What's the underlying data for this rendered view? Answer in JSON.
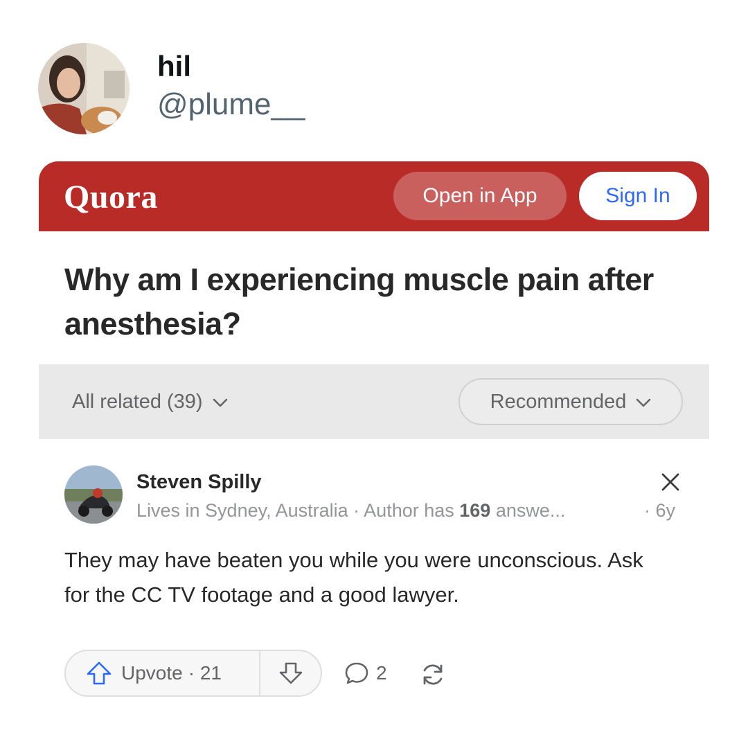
{
  "tweet": {
    "display_name": "hil",
    "handle": "@plume__"
  },
  "quora": {
    "logo": "Quora",
    "open_in_app": "Open in App",
    "sign_in": "Sign In",
    "brand_color": "#b92b27",
    "link_color": "#2e69ff",
    "question": "Why am I experiencing muscle pain after anesthesia?",
    "filter": {
      "all_related": "All related (39)",
      "sort": "Recommended"
    },
    "answer": {
      "author": "Steven Spilly",
      "meta_prefix": "Lives in Sydney, Australia · Author has ",
      "meta_count": "169",
      "meta_suffix": " answe...",
      "age": "· 6y",
      "text": "They may have beaten you while you were unconscious. Ask for the CC TV footage and a good lawyer.",
      "upvote_label": "Upvote",
      "upvote_count": "· 21",
      "comment_count": "2"
    }
  }
}
